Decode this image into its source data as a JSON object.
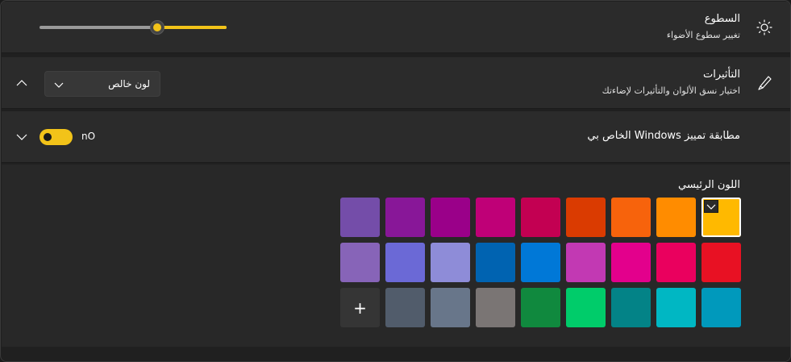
{
  "brightness": {
    "title": "السطوع",
    "subtitle": "تغيير سطوع الأضواء",
    "icon": "sun-icon",
    "level_percent": 63
  },
  "effects": {
    "title": "التأثيرات",
    "subtitle": "اختيار نسق الألوان والتأثيرات لإضاءتك",
    "icon": "brush-icon",
    "dropdown_value": "لون خالص"
  },
  "accent_match": {
    "title": "مطابقة تمييز Windows الخاص بي",
    "toggle_label": "nO",
    "toggle_on": true
  },
  "main_color": {
    "title": "اللون الرئيسي",
    "selected_index": 0,
    "rows": [
      [
        "#FFB900",
        "#FF8C00",
        "#F7630C",
        "#DA3B01",
        "#C30052",
        "#BF0077",
        "#9A0089",
        "#881798",
        "#744DA9"
      ],
      [
        "#E81123",
        "#EA005E",
        "#E3008C",
        "#C239B3",
        "#0078D7",
        "#0063B1",
        "#8E8CD8",
        "#6B69D6",
        "#8764B8"
      ],
      [
        "#0099BC",
        "#00B7C3",
        "#038387",
        "#00CC6A",
        "#10893E",
        "#7A7574",
        "#68768A",
        "#515C6B",
        "add"
      ]
    ]
  },
  "colors": {
    "accent": "#F2C319"
  }
}
